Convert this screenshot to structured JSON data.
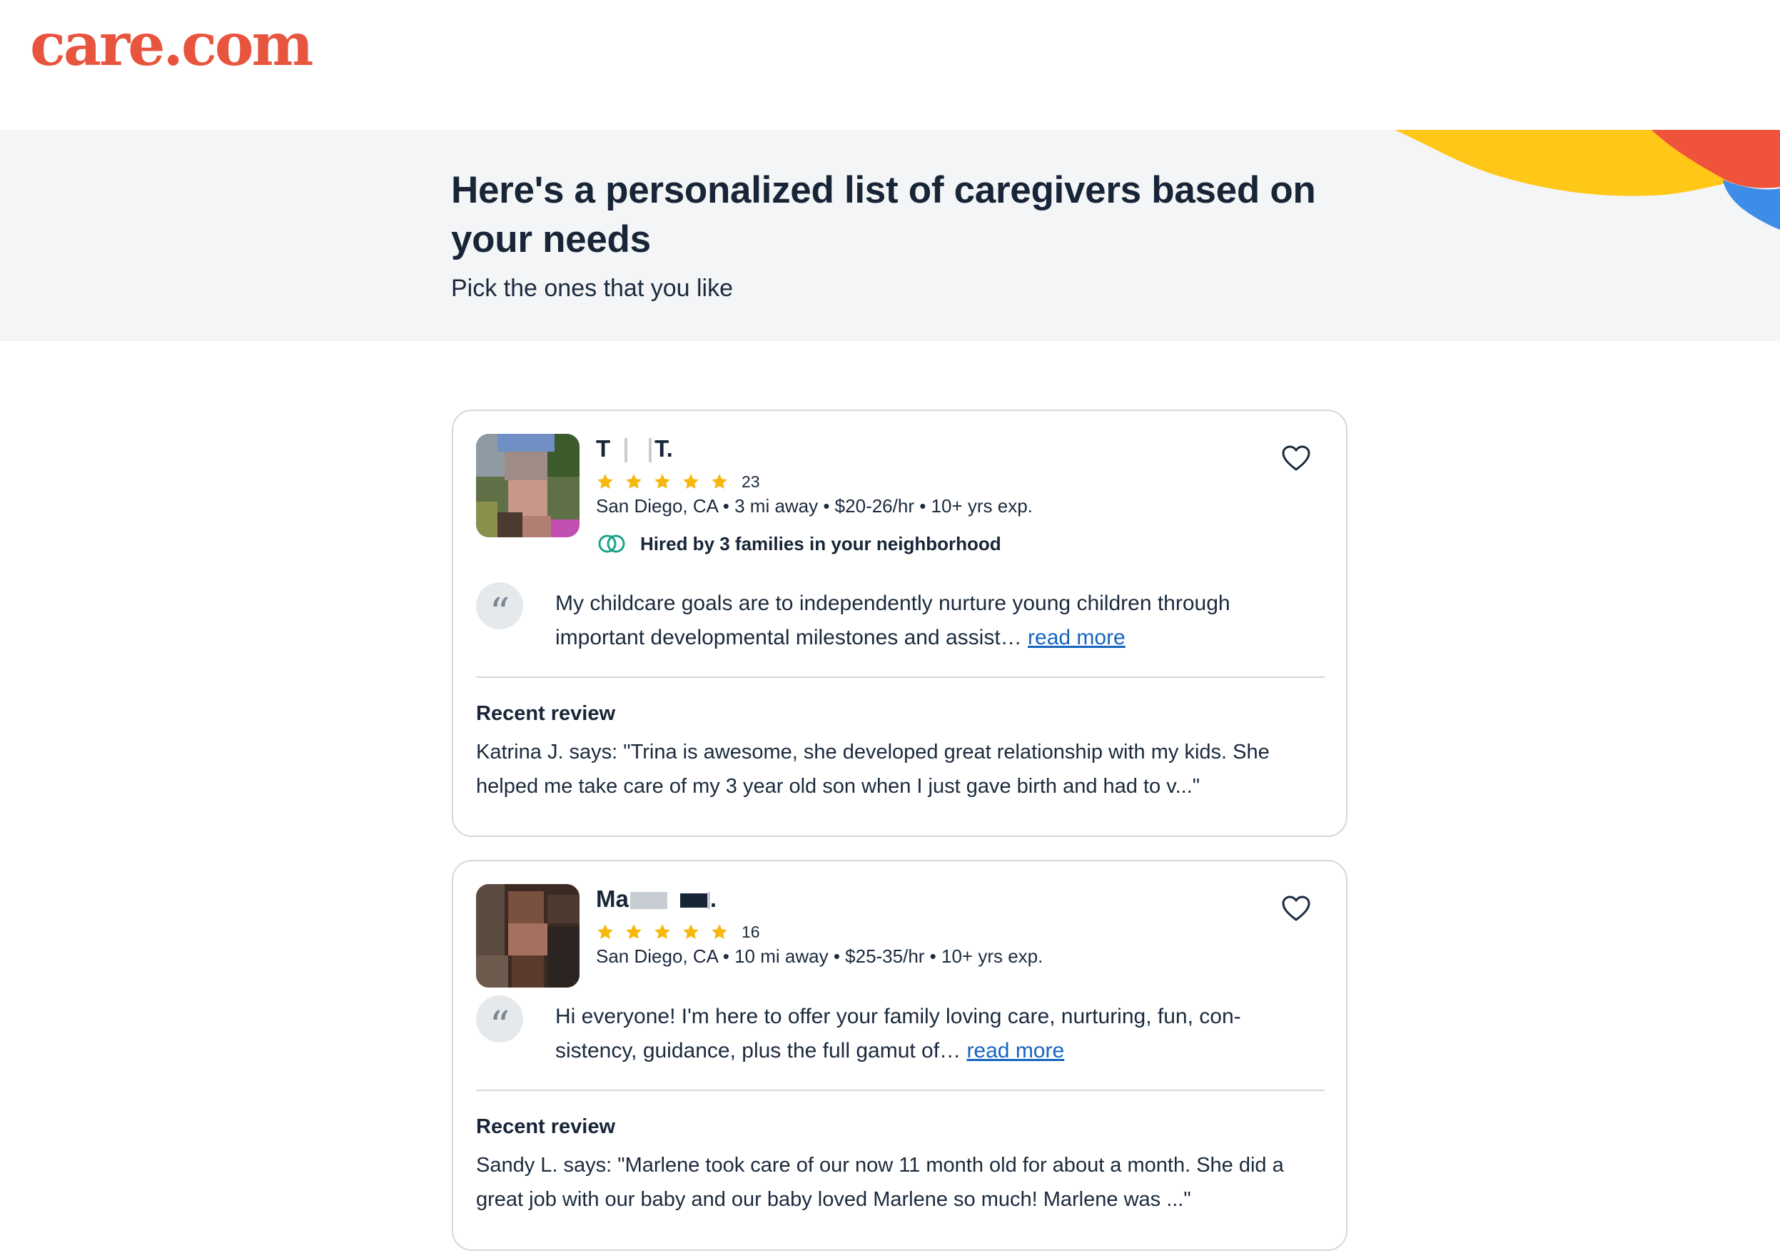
{
  "brand": {
    "logo_text": "care.com",
    "color": "#e8553e"
  },
  "hero": {
    "title": "Here's a personalized list of caregivers based on your needs",
    "subtitle": "Pick the ones that you like"
  },
  "caregivers": [
    {
      "name_start": "T",
      "name_end": "T.",
      "rating": 5,
      "review_count": "23",
      "meta": "San Diego, CA • 3 mi away • $20-26/hr • 10+ yrs exp.",
      "hired_text": "Hired by 3 families in your neighborhood",
      "bio": "My childcare goals are to independently nurture young children through important developmental milestones and assist…",
      "read_more": "read more",
      "review_heading": "Recent review",
      "review_text": "Katrina J. says: \"Trina is awesome, she developed great relationship with my kids. She helped me take care of my 3 year old son when I just gave birth and had to v...\"",
      "favorite_icon": "heart-outline-icon"
    },
    {
      "name_start": "Ma",
      "name_end": ".",
      "rating": 5,
      "review_count": "16",
      "meta": "San Diego, CA • 10 mi away • $25-35/hr • 10+ yrs exp.",
      "bio": "Hi everyone! I'm here to offer your family loving care, nurturing, fun, con-sistency, guidance, plus the full gamut of…",
      "read_more": "read more",
      "review_heading": "Recent review",
      "review_text": "Sandy L. says: \"Marlene took care of our now 11 month old for about a month. She did a great job with our baby and our baby loved Marlene so much! Marlene was ...\"",
      "favorite_icon": "heart-outline-icon"
    }
  ],
  "colors": {
    "star": "#f6b80c",
    "hired_icon": "#1aa38a",
    "link": "#1565c0"
  }
}
